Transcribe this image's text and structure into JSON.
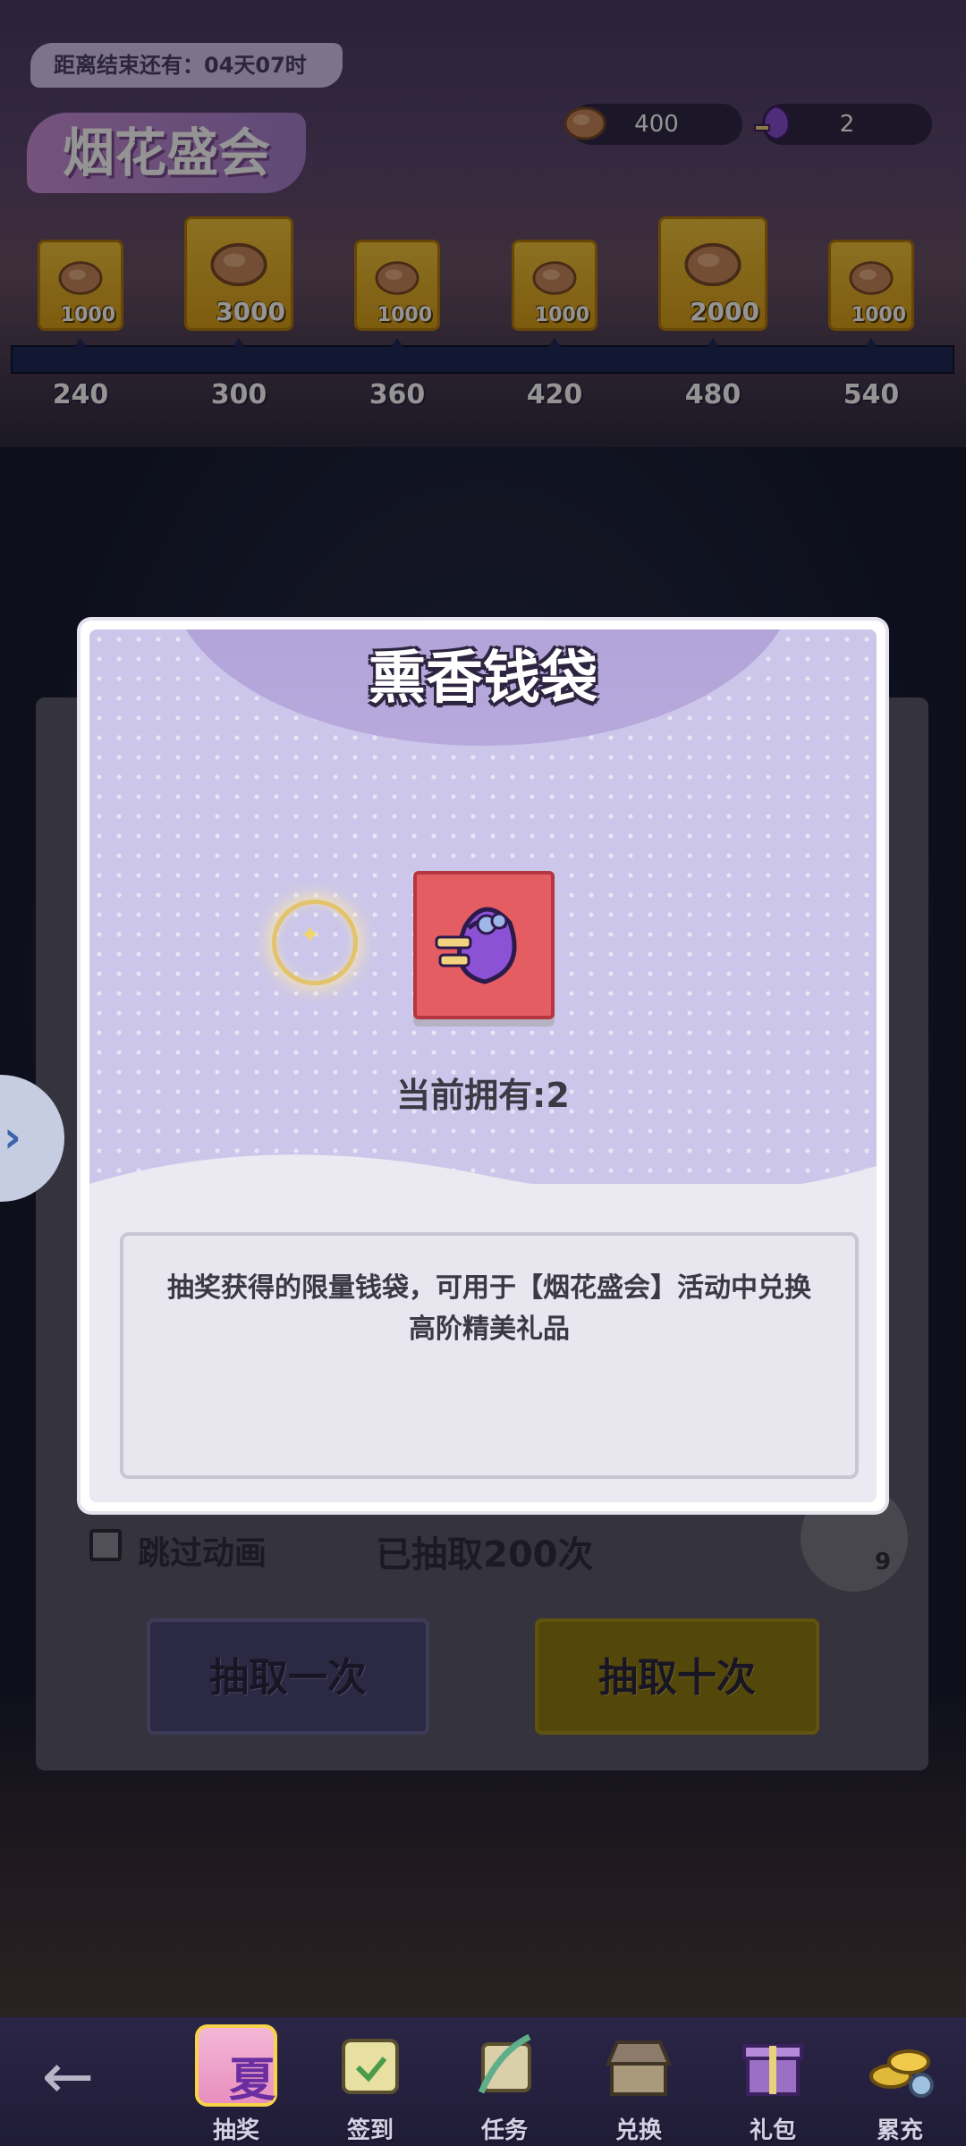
{
  "event": {
    "countdown": "距离结束还有：04天07时",
    "title": "烟花盛会",
    "currency_coins": "400",
    "currency_pouch": "2"
  },
  "rewards": [
    {
      "amount": "1000",
      "milestone": "240"
    },
    {
      "amount": "3000",
      "milestone": "300"
    },
    {
      "amount": "1000",
      "milestone": "360"
    },
    {
      "amount": "1000",
      "milestone": "420"
    },
    {
      "amount": "2000",
      "milestone": "480"
    },
    {
      "amount": "1000",
      "milestone": "540"
    }
  ],
  "draw_panel": {
    "skip_animation_label": "跳过动画",
    "drawn_count": "已抽取200次",
    "ticket_count": "9",
    "draw_once_label": "抽取一次",
    "draw_ten_label": "抽取十次"
  },
  "modal": {
    "title": "熏香钱袋",
    "owned": "当前拥有:2",
    "description_line1": "抽奖获得的限量钱袋，可用于【烟花盛会】活动中兑换",
    "description_line2": "高阶精美礼品",
    "item_icon": "purple-pouch-icon",
    "card_color": "#e45d62"
  },
  "nav": {
    "items": [
      {
        "label": "抽奖",
        "icon": "summer-icon",
        "active": true
      },
      {
        "label": "签到",
        "icon": "calendar-icon"
      },
      {
        "label": "任务",
        "icon": "quill-scroll-icon"
      },
      {
        "label": "兑换",
        "icon": "shop-icon"
      },
      {
        "label": "礼包",
        "icon": "gift-icon"
      },
      {
        "label": "累充",
        "icon": "coins-icon"
      }
    ],
    "active_badge_char": "夏"
  }
}
